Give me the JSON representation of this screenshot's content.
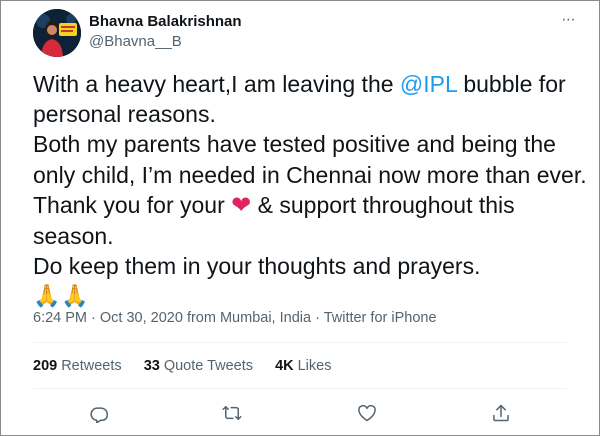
{
  "author": {
    "display_name": "Bhavna Balakrishnan",
    "handle": "@Bhavna__B"
  },
  "more_label": "⋯",
  "tweet": {
    "line1_pre": "With a heavy heart,I am leaving the ",
    "mention": "@IPL",
    "line1_post": " bubble for",
    "line2": "personal reasons.",
    "line3": "Both my parents have tested positive and being the",
    "line4": "only child, I’m needed in Chennai now more than ever.",
    "line5_pre": "Thank you for your ",
    "heart_emoji": "❤",
    "line5_post": " & support throughout this",
    "line6": "season.",
    "line7": "Do keep them in your thoughts and prayers.",
    "pray_emojis": "🙏🙏"
  },
  "meta": {
    "time": "6:24 PM",
    "sep1": " · ",
    "date": "Oct 30, 2020",
    "location": " from Mumbai, India",
    "sep2": " · ",
    "source": "Twitter for iPhone"
  },
  "stats": {
    "retweets_count": "209",
    "retweets_label": "Retweets",
    "quotes_count": "33",
    "quotes_label": "Quote Tweets",
    "likes_count": "4K",
    "likes_label": "Likes"
  },
  "icons": {
    "reply": "reply-icon",
    "retweet": "retweet-icon",
    "like": "like-icon",
    "share": "share-icon"
  },
  "colors": {
    "mention": "#1d9bf0",
    "secondary_text": "#536471",
    "heart": "#e0245e"
  }
}
